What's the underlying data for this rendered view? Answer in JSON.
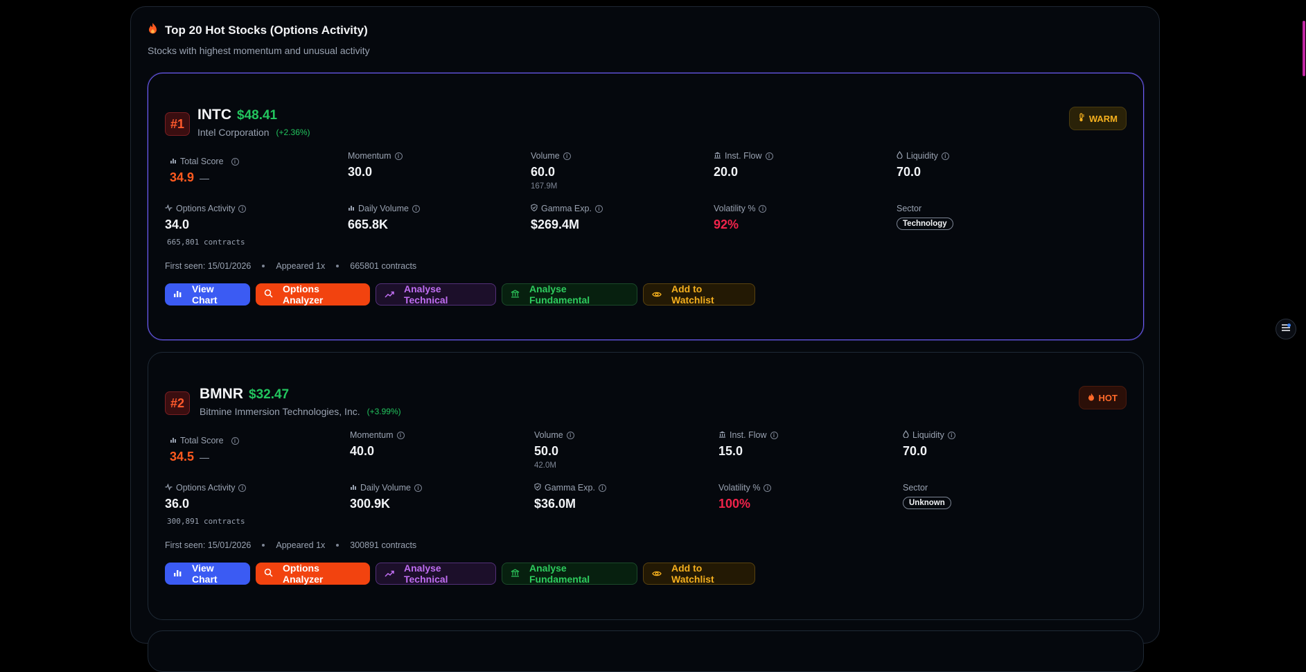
{
  "panel": {
    "title": "Top 20 Hot Stocks (Options Activity)",
    "subtitle": "Stocks with highest momentum and unusual activity",
    "title_icon": "flame-icon"
  },
  "labels": {
    "total_score": "Total Score",
    "momentum": "Momentum",
    "volume": "Volume",
    "inst_flow": "Inst. Flow",
    "liquidity": "Liquidity",
    "options_activity": "Options Activity",
    "daily_volume": "Daily Volume",
    "gamma_exp": "Gamma Exp.",
    "volatility": "Volatility %",
    "sector": "Sector"
  },
  "buttons": {
    "view_chart": "View Chart",
    "options_analyzer": "Options Analyzer",
    "analyse_technical": "Analyse Technical",
    "analyse_fundamental": "Analyse Fundamental",
    "add_watchlist": "Add to Watchlist"
  },
  "colors": {
    "accent_blue": "#3b5bf3",
    "accent_orange": "#f2430f",
    "positive": "#22c55e",
    "negative": "#f0234a",
    "active_border": "#6d5cf6"
  },
  "stocks": [
    {
      "rank": "#1",
      "symbol": "INTC",
      "price": "$48.41",
      "company": "Intel Corporation",
      "change": "(+2.36%)",
      "tag": "WARM",
      "total_score": "34.9",
      "score_dash": "—",
      "momentum": "30.0",
      "volume": "60.0",
      "volume_sub": "167.9M",
      "inst_flow": "20.0",
      "liquidity": "70.0",
      "options_activity": "34.0",
      "contracts_mono": "665,801 contracts",
      "daily_volume": "665.8K",
      "gamma_exp": "$269.4M",
      "volatility": "92%",
      "sector": "Technology",
      "first_seen": "First seen: 15/01/2026",
      "appeared": "Appeared 1x",
      "contracts": "665801 contracts"
    },
    {
      "rank": "#2",
      "symbol": "BMNR",
      "price": "$32.47",
      "company": "Bitmine Immersion Technologies, Inc.",
      "change": "(+3.99%)",
      "tag": "HOT",
      "total_score": "34.5",
      "score_dash": "—",
      "momentum": "40.0",
      "volume": "50.0",
      "volume_sub": "42.0M",
      "inst_flow": "15.0",
      "liquidity": "70.0",
      "options_activity": "36.0",
      "contracts_mono": "300,891 contracts",
      "daily_volume": "300.9K",
      "gamma_exp": "$36.0M",
      "volatility": "100%",
      "sector": "Unknown",
      "first_seen": "First seen: 15/01/2026",
      "appeared": "Appeared 1x",
      "contracts": "300891 contracts"
    }
  ]
}
